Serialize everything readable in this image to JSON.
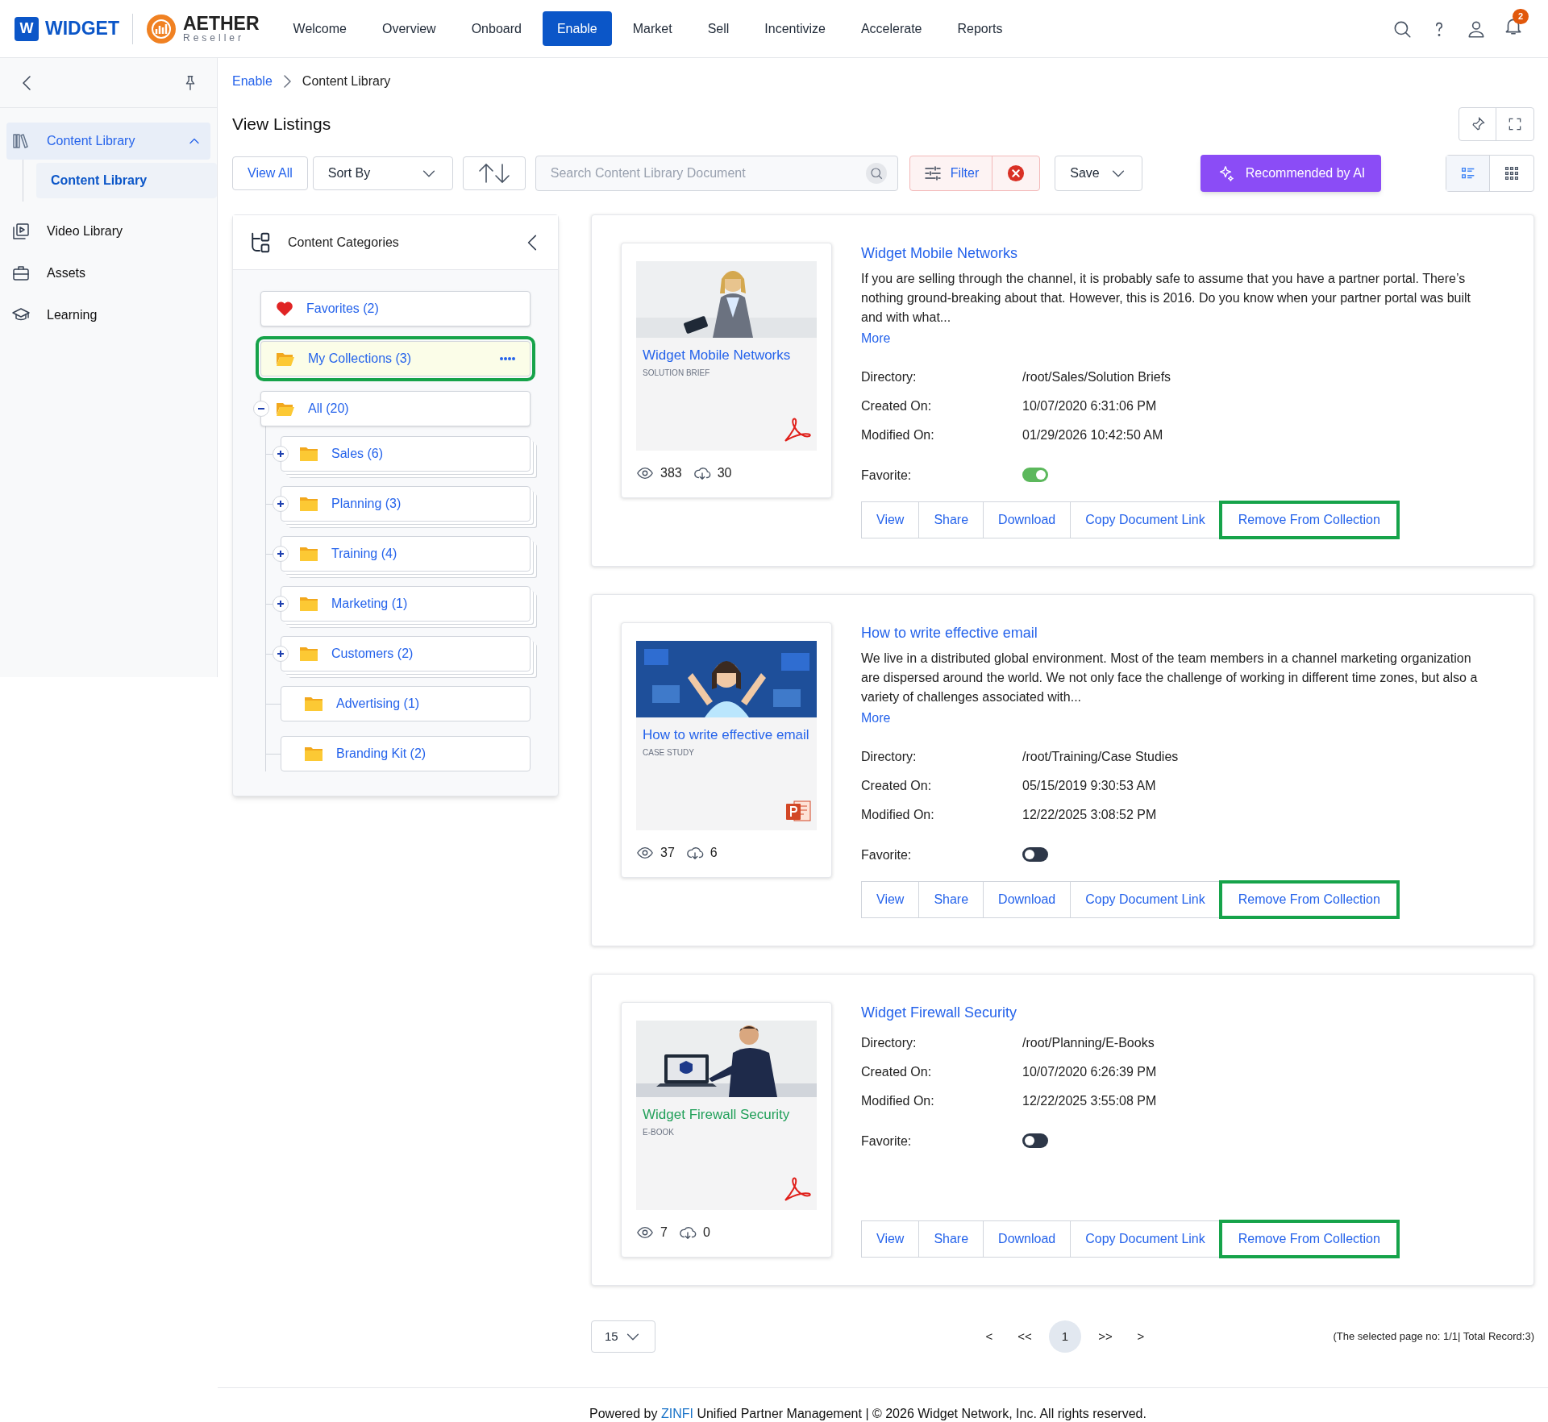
{
  "header": {
    "brand_letter": "W",
    "brand_name": "WIDGET",
    "partner_name": "AETHER",
    "partner_sub": "Reseller",
    "notification_count": "2"
  },
  "nav": [
    {
      "label": "Welcome",
      "selected": false
    },
    {
      "label": "Overview",
      "selected": false
    },
    {
      "label": "Onboard",
      "selected": false
    },
    {
      "label": "Enable",
      "selected": true
    },
    {
      "label": "Market",
      "selected": false
    },
    {
      "label": "Sell",
      "selected": false
    },
    {
      "label": "Incentivize",
      "selected": false
    },
    {
      "label": "Accelerate",
      "selected": false
    },
    {
      "label": "Reports",
      "selected": false
    }
  ],
  "sidebar": {
    "items": [
      {
        "label": "Content Library",
        "expanded": true,
        "selected": true,
        "children": [
          {
            "label": "Content Library",
            "selected": true
          }
        ]
      },
      {
        "label": "Video Library",
        "selected": false
      },
      {
        "label": "Assets",
        "selected": false
      },
      {
        "label": "Learning",
        "selected": false
      }
    ]
  },
  "breadcrumb": [
    {
      "label": "Enable"
    },
    {
      "label": "Content Library"
    }
  ],
  "page_title": "View Listings",
  "toolbar": {
    "view_all": "View All",
    "sort_by": "Sort By",
    "search_placeholder": "Search Content Library Document",
    "filter": "Filter",
    "save": "Save",
    "ai_button": "Recommended by AI"
  },
  "categories": {
    "title": "Content Categories",
    "items": [
      {
        "label": "Favorites (2)",
        "kind": "favorites",
        "selected": false
      },
      {
        "label": "My Collections (3)",
        "kind": "collection",
        "selected": true
      },
      {
        "label": "All (20)",
        "kind": "folder",
        "selected": false,
        "expanded": true,
        "children": [
          {
            "label": "Sales (6)",
            "expanded": false
          },
          {
            "label": "Planning (3)",
            "expanded": false
          },
          {
            "label": "Training (4)",
            "expanded": false
          },
          {
            "label": "Marketing (1)",
            "expanded": false
          },
          {
            "label": "Customers (2)",
            "expanded": false
          },
          {
            "label": "Advertising (1)"
          },
          {
            "label": "Branding Kit (2)"
          }
        ]
      }
    ]
  },
  "documents": [
    {
      "title": "Widget Mobile Networks",
      "description": "If you are selling through the channel, it is probably safe to assume that you have a partner portal. There’s nothing ground-breaking about that. However, this is 2016. Do you know when your partner portal was built and with what...",
      "more": "More",
      "thumbnail": {
        "title": "Widget Mobile Networks",
        "color": "#2563eb",
        "type_label": "SOLUTION BRIEF",
        "file_icon": {
          "kind": "pdf"
        }
      },
      "views": "383",
      "downloads": "30",
      "meta": [
        {
          "label": "Directory:",
          "value": "/root/Sales/Solution Briefs"
        },
        {
          "label": "Created On:",
          "value": "10/07/2020 6:31:06 PM"
        },
        {
          "label": "Modified On:",
          "value": "01/29/2026 10:42:50 AM"
        }
      ],
      "favorite_label": "Favorite:",
      "favorite_on": true,
      "actions": [
        {
          "label": "View",
          "highlighted": false
        },
        {
          "label": "Share",
          "highlighted": false
        },
        {
          "label": "Download",
          "highlighted": false
        },
        {
          "label": "Copy Document Link",
          "highlighted": false
        },
        {
          "label": "Remove From Collection",
          "highlighted": true
        }
      ]
    },
    {
      "title": "How to write effective email",
      "description": "We live in a distributed global environment. Most of the team members in a channel marketing organization are dispersed around the world. We not only face the challenge of working in different time zones, but also a variety of challenges associated with...",
      "more": "More",
      "thumbnail": {
        "title": "How to write effective email",
        "color": "#2563eb",
        "type_label": "CASE STUDY",
        "file_icon": {
          "kind": "ppt"
        }
      },
      "views": "37",
      "downloads": "6",
      "meta": [
        {
          "label": "Directory:",
          "value": "/root/Training/Case Studies"
        },
        {
          "label": "Created On:",
          "value": "05/15/2019 9:30:53 AM"
        },
        {
          "label": "Modified On:",
          "value": "12/22/2025 3:08:52 PM"
        }
      ],
      "favorite_label": "Favorite:",
      "favorite_on": false,
      "actions": [
        {
          "label": "View",
          "highlighted": false
        },
        {
          "label": "Share",
          "highlighted": false
        },
        {
          "label": "Download",
          "highlighted": false
        },
        {
          "label": "Copy Document Link",
          "highlighted": false
        },
        {
          "label": "Remove From Collection",
          "highlighted": true
        }
      ]
    },
    {
      "title": "Widget Firewall Security",
      "thumbnail": {
        "title": "Widget Firewall Security",
        "color": "#22a05a",
        "type_label": "E-BOOK",
        "file_icon": {
          "kind": "pdf"
        }
      },
      "views": "7",
      "downloads": "0",
      "meta": [
        {
          "label": "Directory:",
          "value": "/root/Planning/E-Books"
        },
        {
          "label": "Created On:",
          "value": "10/07/2020 6:26:39 PM"
        },
        {
          "label": "Modified On:",
          "value": "12/22/2025 3:55:08 PM"
        }
      ],
      "favorite_label": "Favorite:",
      "favorite_on": false,
      "actions": [
        {
          "label": "View",
          "highlighted": false
        },
        {
          "label": "Share",
          "highlighted": false
        },
        {
          "label": "Download",
          "highlighted": false
        },
        {
          "label": "Copy Document Link",
          "highlighted": false
        },
        {
          "label": "Remove From Collection",
          "highlighted": true
        }
      ]
    }
  ],
  "pagination": {
    "page_size": "15",
    "first": "<",
    "prev": "<<",
    "pages": [
      {
        "label": "1",
        "selected": true
      }
    ],
    "next": ">>",
    "last": ">",
    "summary": "(The selected page no: 1/1| Total Record:3)"
  },
  "footer": {
    "prefix": "Powered by ",
    "link": "ZINFI",
    "suffix": " Unified Partner Management | © 2026 Widget Network, Inc. All rights reserved."
  }
}
